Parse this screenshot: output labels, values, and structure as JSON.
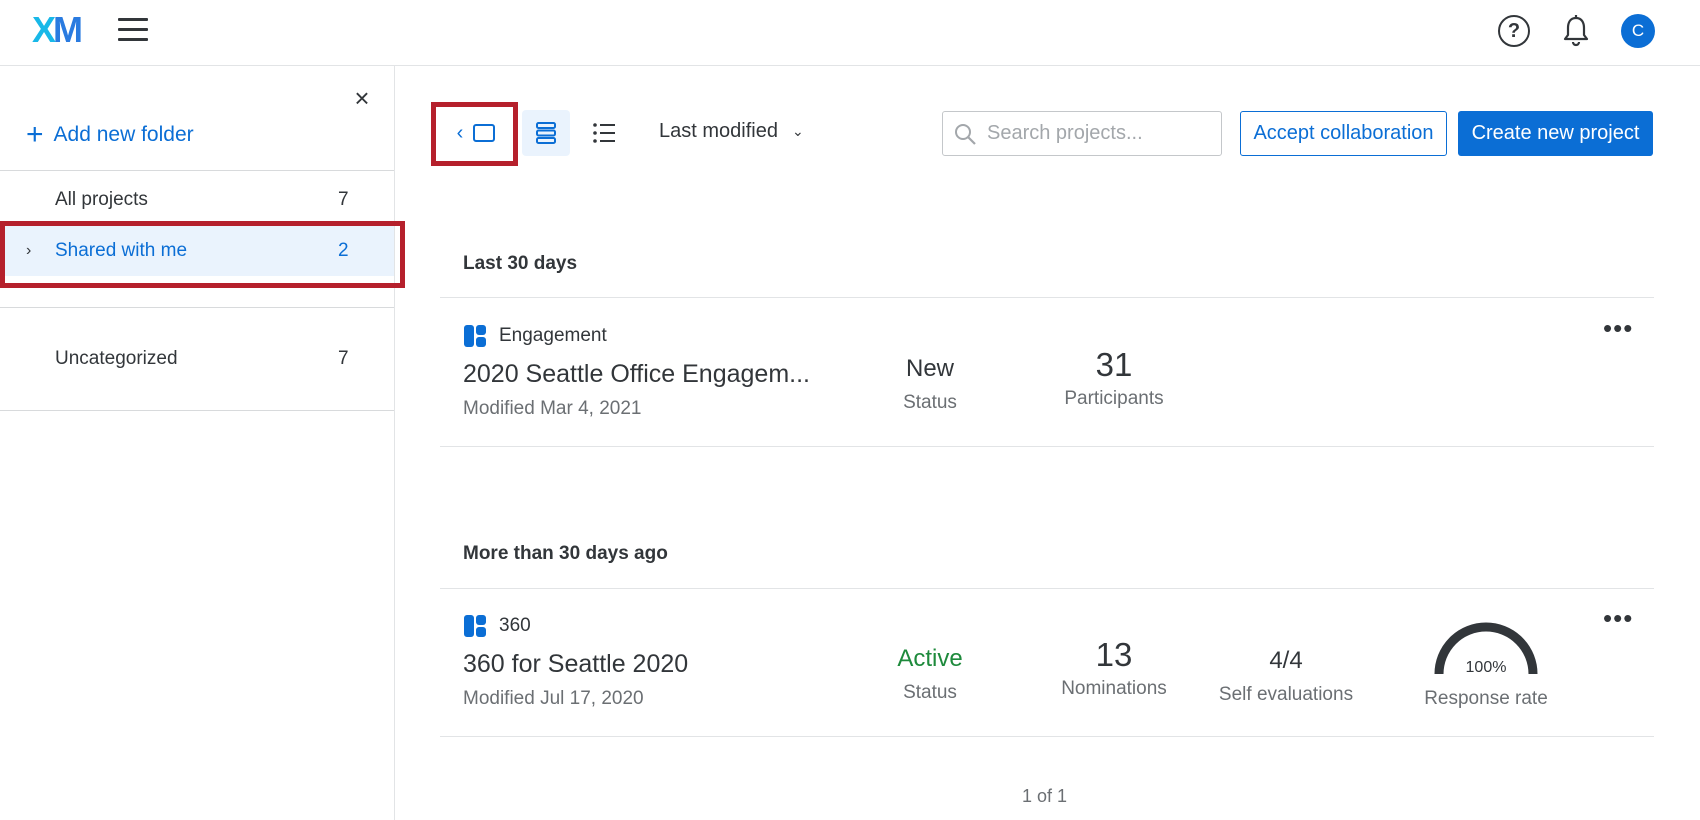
{
  "header": {
    "logo_x": "X",
    "logo_m": "M",
    "avatar_initial": "C",
    "help_glyph": "?",
    "icons": [
      "menu-icon",
      "help-icon",
      "bell-icon"
    ]
  },
  "sidebar": {
    "close_glyph": "×",
    "add_folder_label": "Add new folder",
    "items": [
      {
        "label": "All projects",
        "count": "7"
      },
      {
        "label": "Shared with me",
        "count": "2"
      },
      {
        "label": "Uncategorized",
        "count": "7"
      }
    ]
  },
  "toolbar": {
    "sort_label": "Last modified",
    "search_placeholder": "Search projects...",
    "accept_label": "Accept collaboration",
    "create_label": "Create new project"
  },
  "sections": [
    {
      "heading": "Last 30 days",
      "project": {
        "type": "Engagement",
        "title": "2020 Seattle Office Engagem...",
        "modified": "Modified Mar 4, 2021",
        "status_value": "New",
        "status_label": "Status",
        "participants_value": "31",
        "participants_label": "Participants"
      }
    },
    {
      "heading": "More than 30 days ago",
      "project": {
        "type": "360",
        "title": "360 for Seattle 2020",
        "modified": "Modified Jul 17, 2020",
        "status_value": "Active",
        "status_label": "Status",
        "nominations_value": "13",
        "nominations_label": "Nominations",
        "self_eval_value": "4/4",
        "self_eval_label": "Self evaluations",
        "response_rate_value": "100%",
        "response_rate_label": "Response rate",
        "response_rate_fraction": 1.0
      }
    }
  ],
  "pagination": "1 of 1",
  "colors": {
    "accent": "#0b6ed5",
    "active_status": "#1e8a3c",
    "highlight": "#b5202c",
    "selected_bg": "#eaf3fd"
  }
}
